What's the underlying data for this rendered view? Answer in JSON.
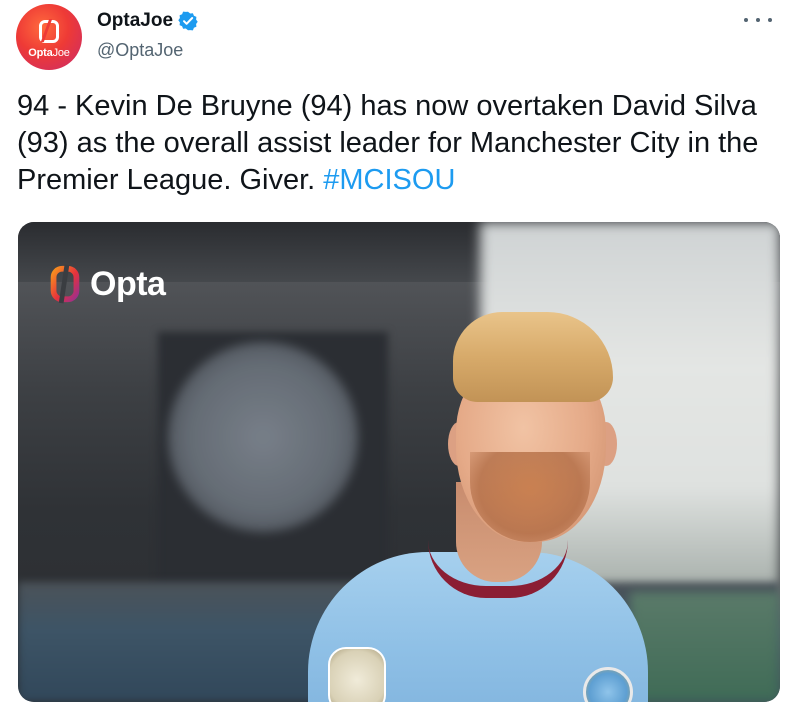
{
  "author": {
    "display_name": "OptaJoe",
    "handle": "@OptaJoe",
    "verified": true,
    "avatar_text_bold": "Opta",
    "avatar_text_light": "Joe",
    "avatar_colors": [
      "#ff6a3d",
      "#ee3a36",
      "#c92a6b"
    ]
  },
  "tweet": {
    "text": "94 - Kevin De Bruyne (94) has now overtaken David Silva (93) as the overall assist leader for Manchester City in the Premier League. Giver. ",
    "hashtag": "#MCISOU",
    "hashtag_color": "#1d9bf0"
  },
  "media": {
    "logo_text": "Opta",
    "logo_colors": [
      "#f7941d",
      "#e6323c",
      "#9b2f8e"
    ],
    "shirt_color": "#8fc0e6",
    "collar_color": "#8b1e34"
  },
  "icons": {
    "more": "more-horizontal-icon",
    "verified": "verified-badge-icon"
  }
}
